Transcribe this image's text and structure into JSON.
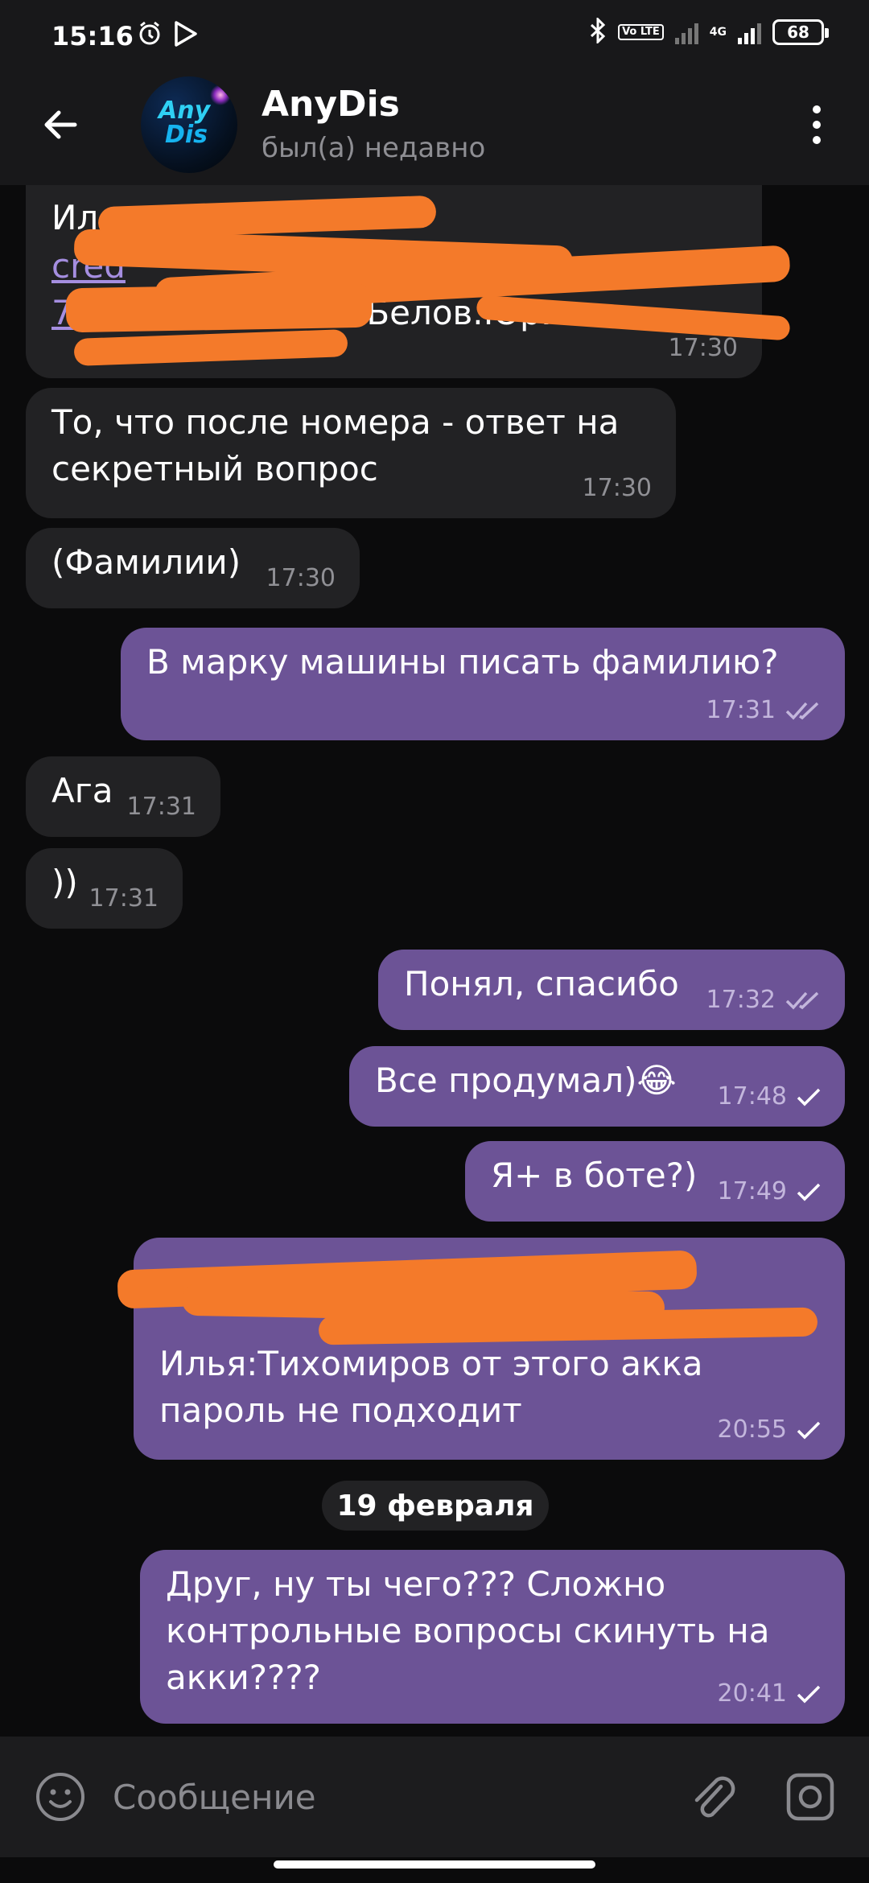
{
  "status_bar": {
    "time": "15:16",
    "network_label": "4G",
    "volte_label": "Vo LTE",
    "battery": "68"
  },
  "header": {
    "title": "AnyDis",
    "subtitle": "был(а) недавно",
    "avatar_text_top": "Any",
    "avatar_text_bottom": "Dis"
  },
  "messages": [
    {
      "direction": "in",
      "text_visible": "Ил",
      "link_hint": "cred",
      "phone_hint": "79",
      "tail": ".Белов.Юри",
      "time": "17:30"
    },
    {
      "direction": "in",
      "text": "То, что после номера - ответ на секретный вопрос",
      "time": "17:30"
    },
    {
      "direction": "in",
      "text": "(Фамилии)",
      "time": "17:30"
    },
    {
      "direction": "out",
      "text": "В марку машины писать фамилию?",
      "time": "17:31",
      "status": "read"
    },
    {
      "direction": "in",
      "text": "Ага",
      "time": "17:31"
    },
    {
      "direction": "in",
      "text": "))",
      "time": "17:31"
    },
    {
      "direction": "out",
      "text": "Понял, спасибо",
      "time": "17:32",
      "status": "read"
    },
    {
      "direction": "out",
      "text": "Все продумал)😂",
      "time": "17:48",
      "status": "sent"
    },
    {
      "direction": "out",
      "text": "Я+ в боте?)",
      "time": "17:49",
      "status": "sent"
    },
    {
      "direction": "out",
      "text_line3": "Илья:Тихомиров от этого акка",
      "text_line4": "пароль не подходит",
      "time": "20:55",
      "status": "sent"
    },
    {
      "direction": "out",
      "text": "Друг, ну ты чего??? Сложно контрольные вопросы скинуть на акки????",
      "time": "20:41",
      "status": "sent"
    }
  ],
  "date_separator": "19 февраля",
  "input": {
    "placeholder": "Сообщение"
  },
  "colors": {
    "incoming_bubble": "#222224",
    "outgoing_bubble": "#6c5396",
    "redaction": "#f47a2a",
    "background": "#0b0b0c"
  },
  "icons": [
    "back-arrow-icon",
    "more-vert-icon",
    "emoji-icon",
    "attach-icon",
    "camera-icon",
    "double-check-icon",
    "single-check-icon"
  ]
}
